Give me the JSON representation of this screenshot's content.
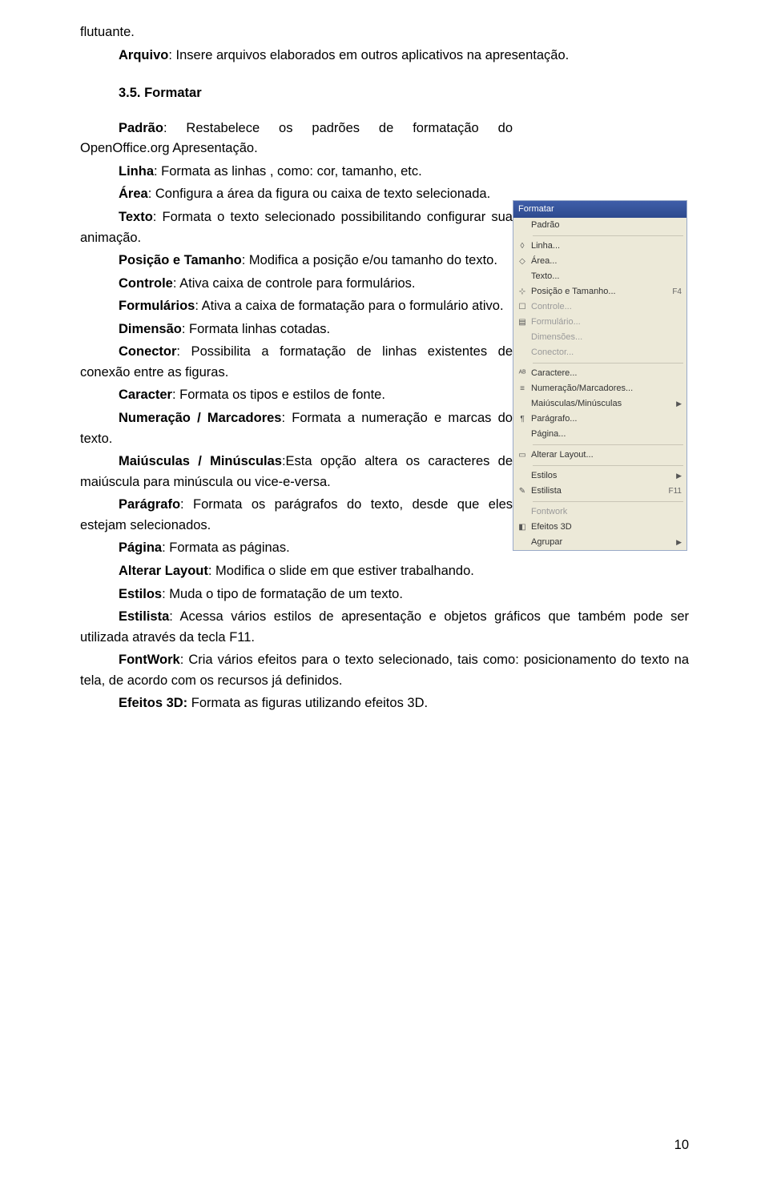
{
  "top": {
    "flutuante": "flutuante.",
    "arquivo_b": "Arquivo",
    "arquivo_t": ": Insere arquivos elaborados em outros aplicativos na apresentação."
  },
  "heading": "3.5. Formatar",
  "body": {
    "padrao_b": "Padrão",
    "padrao_t": ": Restabelece os padrões de formatação do OpenOffice.org Apresentação.",
    "linha_b": "Linha",
    "linha_t": ": Formata as linhas , como: cor, tamanho, etc.",
    "area_b": "Área",
    "area_t": ": Configura a área da figura ou caixa de texto selecionada.",
    "texto_b": "Texto",
    "texto_t": ": Formata o texto selecionado possibilitando configurar sua animação.",
    "postam_b": "Posição e Tamanho",
    "postam_t": ": Modifica a posição e/ou tamanho do texto.",
    "controle_b": "Controle",
    "controle_t": ": Ativa caixa de controle para formulários.",
    "form_b": "Formulários",
    "form_t": ": Ativa a caixa de formatação para o formulário ativo.",
    "dim_b": "Dimensão",
    "dim_t": ": Formata linhas cotadas.",
    "conector_b": "Conector",
    "conector_t": ": Possibilita a formatação de linhas existentes de conexão entre as figuras.",
    "caracter_b": "Caracter",
    "caracter_t": ": Formata os tipos e estilos de fonte.",
    "num_b": "Numeração / Marcadores",
    "num_t": ": Formata a numeração e marcas do texto.",
    "maimin_b": "Maiúsculas / Minúsculas",
    "maimin_t": ":Esta opção altera os caracteres de maiúscula para minúscula ou vice-e-versa.",
    "parag_b": "Parágrafo",
    "parag_t": ": Formata os parágrafos do texto, desde que eles estejam selecionados.",
    "pagina_b": "Página",
    "pagina_t": ": Formata as páginas.",
    "altlay_b": "Alterar Layout",
    "altlay_t": ": Modifica o slide em que estiver trabalhando.",
    "estilos_b": "Estilos",
    "estilos_t": ": Muda o tipo de formatação de um texto.",
    "estilista_b": "Estilista",
    "estilista_t": ": Acessa vários estilos de apresentação e objetos gráficos que também pode ser utilizada através da tecla F11.",
    "fontwork_b": "FontWork",
    "fontwork_t": ": Cria vários efeitos para o texto selecionado, tais como: posicionamento do texto na tela, de acordo com os recursos já definidos.",
    "ef3d_b": "Efeitos 3D:",
    "ef3d_t": " Formata as figuras utilizando efeitos 3D."
  },
  "menu": {
    "title": "Formatar",
    "items": [
      {
        "icon": "",
        "label": "Padrão",
        "shortcut": "",
        "arrow": false,
        "dim": false
      },
      {
        "sep": true
      },
      {
        "icon": "◊",
        "label": "Linha...",
        "shortcut": "",
        "arrow": false,
        "dim": false
      },
      {
        "icon": "◇",
        "label": "Área...",
        "shortcut": "",
        "arrow": false,
        "dim": false
      },
      {
        "icon": "",
        "label": "Texto...",
        "shortcut": "",
        "arrow": false,
        "dim": false
      },
      {
        "icon": "⊹",
        "label": "Posição e Tamanho...",
        "shortcut": "F4",
        "arrow": false,
        "dim": false
      },
      {
        "icon": "☐",
        "label": "Controle...",
        "shortcut": "",
        "arrow": false,
        "dim": true
      },
      {
        "icon": "▤",
        "label": "Formulário...",
        "shortcut": "",
        "arrow": false,
        "dim": true
      },
      {
        "icon": "",
        "label": "Dimensões...",
        "shortcut": "",
        "arrow": false,
        "dim": true
      },
      {
        "icon": "",
        "label": "Conector...",
        "shortcut": "",
        "arrow": false,
        "dim": true
      },
      {
        "sep": true
      },
      {
        "icon": "ᴬᴮ",
        "label": "Caractere...",
        "shortcut": "",
        "arrow": false,
        "dim": false
      },
      {
        "icon": "≡",
        "label": "Numeração/Marcadores...",
        "shortcut": "",
        "arrow": false,
        "dim": false
      },
      {
        "icon": "",
        "label": "Maiúsculas/Minúsculas",
        "shortcut": "",
        "arrow": true,
        "dim": false
      },
      {
        "icon": "¶",
        "label": "Parágrafo...",
        "shortcut": "",
        "arrow": false,
        "dim": false
      },
      {
        "icon": "",
        "label": "Página...",
        "shortcut": "",
        "arrow": false,
        "dim": false
      },
      {
        "sep": true
      },
      {
        "icon": "▭",
        "label": "Alterar Layout...",
        "shortcut": "",
        "arrow": false,
        "dim": false
      },
      {
        "sep": true
      },
      {
        "icon": "",
        "label": "Estilos",
        "shortcut": "",
        "arrow": true,
        "dim": false
      },
      {
        "icon": "✎",
        "label": "Estilista",
        "shortcut": "F11",
        "arrow": false,
        "dim": false
      },
      {
        "sep": true
      },
      {
        "icon": "",
        "label": "Fontwork",
        "shortcut": "",
        "arrow": false,
        "dim": true
      },
      {
        "icon": "◧",
        "label": "Efeitos 3D",
        "shortcut": "",
        "arrow": false,
        "dim": false
      },
      {
        "icon": "",
        "label": "Agrupar",
        "shortcut": "",
        "arrow": true,
        "dim": false
      }
    ]
  },
  "page_number": "10"
}
